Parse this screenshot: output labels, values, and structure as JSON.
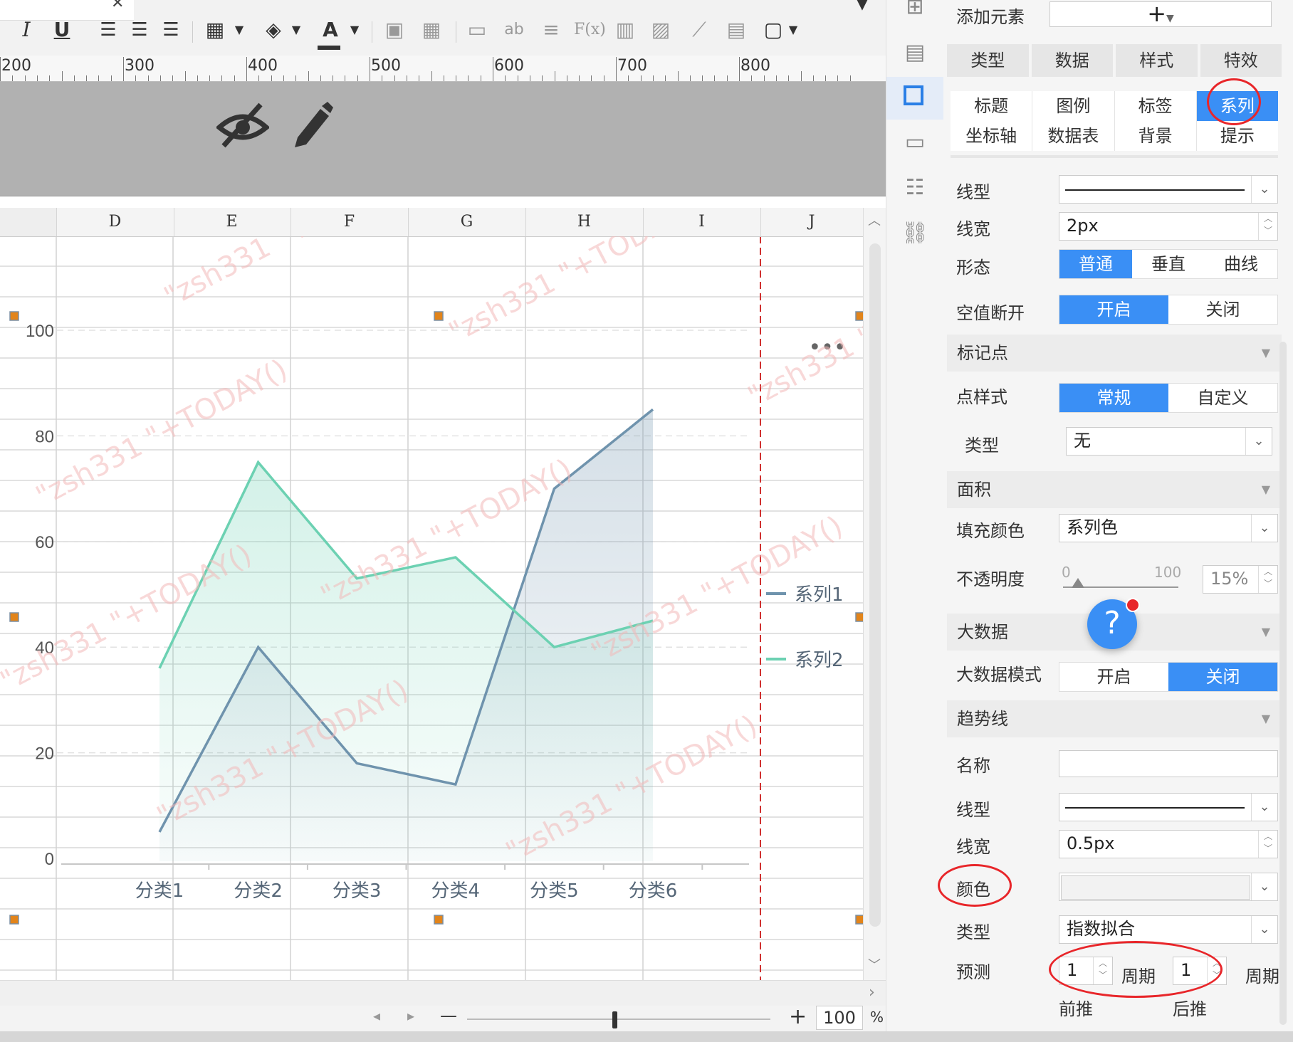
{
  "toolbar": {
    "italic": "I",
    "underline": "U",
    "font_color": "A",
    "ab": "ab",
    "fx": "F(x)"
  },
  "ruler": {
    "marks": [
      "200",
      "300",
      "400",
      "500",
      "600",
      "700",
      "800"
    ]
  },
  "sheet": {
    "columns": [
      "D",
      "E",
      "F",
      "G",
      "H",
      "I",
      "J"
    ]
  },
  "chart_data": {
    "type": "area",
    "categories": [
      "分类1",
      "分类2",
      "分类3",
      "分类4",
      "分类5",
      "分类6"
    ],
    "series": [
      {
        "name": "系列1",
        "values": [
          5,
          40,
          18,
          14,
          70,
          85
        ],
        "color": "#6f93ad"
      },
      {
        "name": "系列2",
        "values": [
          36,
          75,
          53,
          57,
          40,
          45
        ],
        "color": "#6cd1b2"
      }
    ],
    "yticks": [
      "0",
      "20",
      "40",
      "60",
      "80",
      "100"
    ],
    "ylim": [
      0,
      100
    ],
    "legend": "right",
    "more_menu": "•••"
  },
  "watermark": "\"zsh331 \"+TODAY()",
  "statusbar": {
    "zoom": "100",
    "zoom_unit": "%",
    "minus": "—",
    "plus": "+"
  },
  "panel": {
    "add_element_label": "添加元素",
    "add_button": "+",
    "main_tabs": [
      "类型",
      "数据",
      "样式",
      "特效"
    ],
    "sub_tabs_row1": [
      "标题",
      "图例",
      "标签",
      "系列"
    ],
    "sub_tabs_row2": [
      "坐标轴",
      "数据表",
      "背景",
      "提示"
    ],
    "line_type_label": "线型",
    "line_width_label": "线宽",
    "line_width_value": "2px",
    "shape_label": "形态",
    "shape_options": [
      "普通",
      "垂直",
      "曲线"
    ],
    "null_break_label": "空值断开",
    "onoff_options": [
      "开启",
      "关闭"
    ],
    "marker_section": "标记点",
    "point_style_label": "点样式",
    "point_style_options": [
      "常规",
      "自定义"
    ],
    "marker_type_label": "类型",
    "marker_type_value": "无",
    "area_section": "面积",
    "fill_color_label": "填充颜色",
    "fill_color_value": "系列色",
    "opacity_label": "不透明度",
    "opacity_min": "0",
    "opacity_max": "100",
    "opacity_value": "15%",
    "bigdata_section": "大数据",
    "bigdata_mode_label": "大数据模式",
    "trend_section": "趋势线",
    "trend_name_label": "名称",
    "trend_name_value": "",
    "trend_line_type_label": "线型",
    "trend_line_width_label": "线宽",
    "trend_line_width_value": "0.5px",
    "trend_color_label": "颜色",
    "trend_type_label": "类型",
    "trend_type_value": "指数拟合",
    "forecast_label": "预测",
    "forecast_forward_value": "1",
    "forecast_backward_value": "1",
    "period_label": "周期",
    "forward_label": "前推",
    "backward_label": "后推",
    "help": "?"
  },
  "colors": {
    "accent": "#3a8ff5",
    "annotation": "#e8262a",
    "help": "#3a8ff5"
  }
}
